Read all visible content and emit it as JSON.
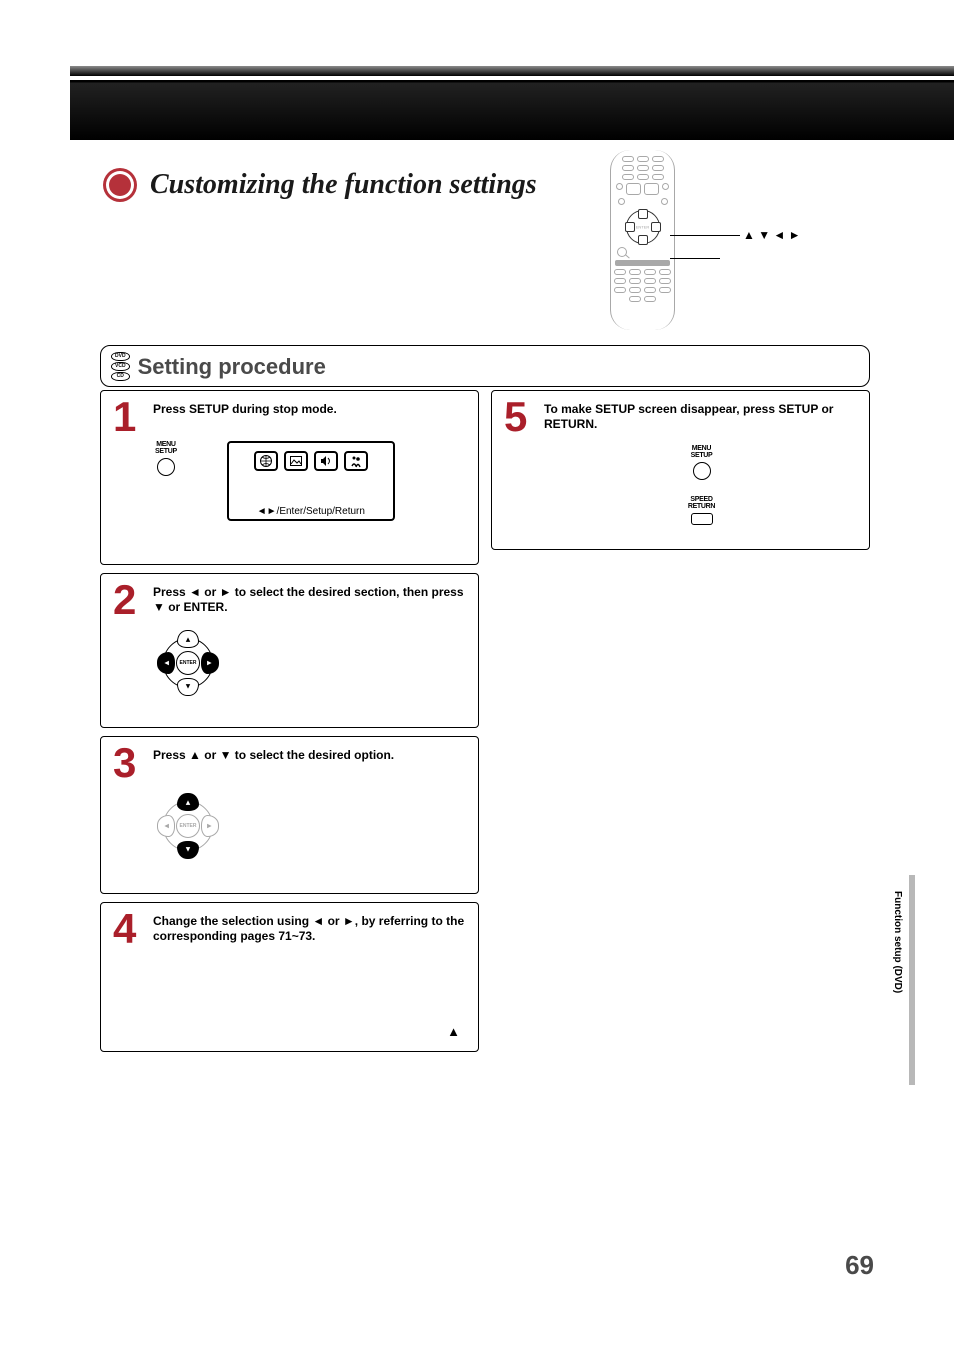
{
  "page": {
    "title": "Customizing the function settings",
    "section": "Setting procedure",
    "disc_types": [
      "DVD",
      "VCD",
      "CD"
    ],
    "remote_arrows": "▲ ▼ ◄ ►",
    "page_number": "69",
    "side_tab": "Function setup (DVD)"
  },
  "osd": {
    "hint": "◄►/Enter/Setup/Return"
  },
  "steps": {
    "s1": {
      "n": "1",
      "text": "Press SETUP during stop mode.",
      "btn_label": "MENU\nSETUP"
    },
    "s2": {
      "n": "2",
      "text": "Press ◄ or ► to select the desired section, then press ▼ or ENTER.",
      "enter": "ENTER"
    },
    "s3": {
      "n": "3",
      "text": "Press ▲ or ▼ to select the desired option.",
      "enter": "ENTER"
    },
    "s4": {
      "n": "4",
      "text": "Change the selection using ◄ or ►, by referring to the corresponding pages 71~73.",
      "arrow": "▲"
    },
    "s5": {
      "n": "5",
      "text": "To make SETUP screen disappear, press SETUP or RETURN.",
      "btn1": "MENU\nSETUP",
      "btn2": "SPEED\nRETURN"
    }
  }
}
